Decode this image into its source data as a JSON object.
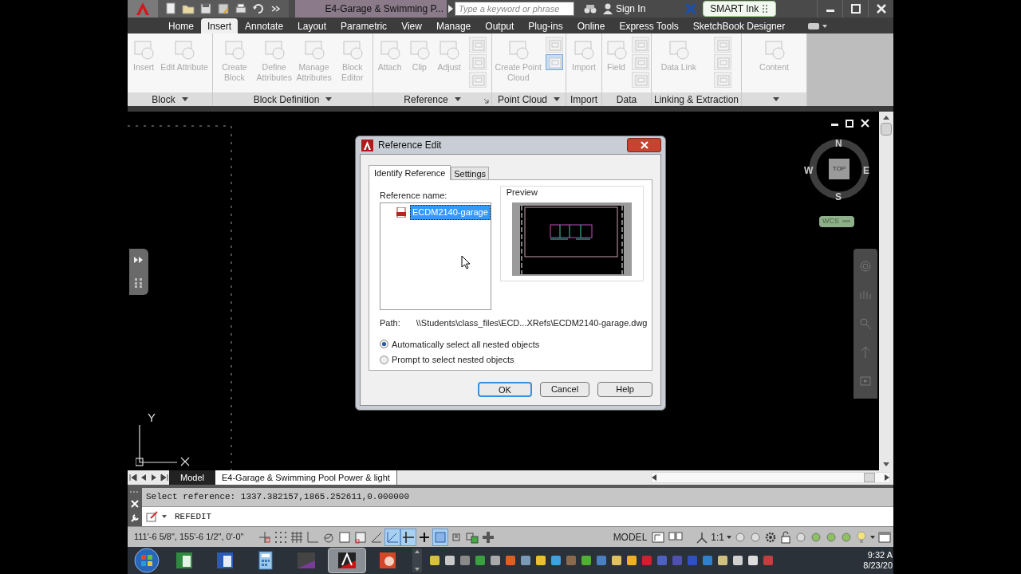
{
  "title_bar": {
    "title": "E4-Garage & Swimming P...",
    "search_placeholder": "Type a keyword or phrase",
    "sign_in": "Sign In",
    "smart_ink": "SMART Ink"
  },
  "ribbon_tabs": [
    {
      "label": "Home",
      "selected": false
    },
    {
      "label": "Insert",
      "selected": true
    },
    {
      "label": "Annotate",
      "selected": false
    },
    {
      "label": "Layout",
      "selected": false
    },
    {
      "label": "Parametric",
      "selected": false
    },
    {
      "label": "View",
      "selected": false
    },
    {
      "label": "Manage",
      "selected": false
    },
    {
      "label": "Output",
      "selected": false
    },
    {
      "label": "Plug-ins",
      "selected": false
    },
    {
      "label": "Online",
      "selected": false
    },
    {
      "label": "Express Tools",
      "selected": false
    },
    {
      "label": "SketchBook Designer",
      "selected": false
    }
  ],
  "ribbon_panels": [
    {
      "title": "Block",
      "has_menu": true,
      "launcher": false,
      "buttons": [
        {
          "label": "Insert",
          "disabled": true
        },
        {
          "label": "Edit Attribute",
          "disabled": true
        }
      ]
    },
    {
      "title": "Block Definition",
      "has_menu": true,
      "launcher": false,
      "buttons": [
        {
          "label": "Create Block",
          "disabled": true
        },
        {
          "label": "Define Attributes",
          "disabled": true
        },
        {
          "label": "Manage Attributes",
          "disabled": true
        },
        {
          "label": "Block Editor",
          "disabled": true
        }
      ]
    },
    {
      "title": "Reference",
      "has_menu": true,
      "launcher": true,
      "buttons": [
        {
          "label": "Attach",
          "disabled": true
        },
        {
          "label": "Clip",
          "disabled": true
        },
        {
          "label": "Adjust",
          "disabled": true
        }
      ],
      "small_buttons": [
        {
          "highlighted": false
        },
        {
          "highlighted": false
        },
        {
          "highlighted": false
        }
      ]
    },
    {
      "title": "Point Cloud",
      "has_menu": true,
      "launcher": false,
      "buttons": [
        {
          "label": "Create Point Cloud",
          "disabled": true
        }
      ],
      "small_buttons": [
        {
          "highlighted": false
        },
        {
          "highlighted": true
        }
      ]
    },
    {
      "title": "Import",
      "has_menu": false,
      "launcher": false,
      "buttons": [
        {
          "label": "Import",
          "disabled": true
        }
      ]
    },
    {
      "title": "Data",
      "has_menu": false,
      "launcher": false,
      "buttons": [
        {
          "label": "Field",
          "disabled": true
        }
      ],
      "small_buttons": [
        {
          "highlighted": false
        },
        {
          "highlighted": false
        },
        {
          "highlighted": false
        }
      ]
    },
    {
      "title": "Linking & Extraction",
      "has_menu": false,
      "launcher": false,
      "buttons": [
        {
          "label": "Data Link",
          "disabled": true
        }
      ],
      "small_buttons": [
        {
          "highlighted": false
        },
        {
          "highlighted": false
        },
        {
          "highlighted": false
        }
      ]
    },
    {
      "has_menu": true,
      "launcher": false,
      "buttons": [
        {
          "label": "Content",
          "disabled": true
        }
      ]
    }
  ],
  "dialog": {
    "title": "Reference Edit",
    "tabs": [
      {
        "label": "Identify Reference",
        "selected": true
      },
      {
        "label": "Settings",
        "selected": false
      }
    ],
    "reference_label": "Reference name:",
    "references": [
      {
        "name": "ECDM2140-garage",
        "selected": true
      }
    ],
    "preview_label": "Preview",
    "path_label": "Path:",
    "path": "\\\\Students\\class_files\\ECD...XRefs\\ECDM2140-garage.dwg",
    "options": [
      {
        "label": "Automatically select all nested objects",
        "selected": true
      },
      {
        "label": "Prompt to select nested objects",
        "selected": false
      }
    ],
    "buttons": [
      {
        "label": "OK",
        "default": true
      },
      {
        "label": "Cancel",
        "default": false
      },
      {
        "label": "Help",
        "default": false
      }
    ]
  },
  "viewcube": {
    "top": "TOP",
    "north": "N",
    "south": "S",
    "east": "E",
    "west": "W",
    "ucs": "WCS"
  },
  "ucs_icon": {
    "y_label": "Y"
  },
  "layout_tabs": [
    {
      "label": "Model",
      "selected": true
    },
    {
      "label": "E4-Garage & Swimming Pool Power & light",
      "selected": false
    }
  ],
  "command_line": {
    "history": "Select reference: 1337.382157,1865.252611,0.000000",
    "input": "REFEDIT"
  },
  "status_bar": {
    "coordinates": "111'-6 5/8\", 155'-6 1/2\", 0'-0\"",
    "toggles": [
      {
        "on": false
      },
      {
        "on": false
      },
      {
        "on": false
      },
      {
        "on": false
      },
      {
        "on": false
      },
      {
        "on": false
      },
      {
        "on": false
      },
      {
        "on": false
      },
      {
        "on": true
      },
      {
        "on": true
      },
      {
        "on": false
      },
      {
        "on": true
      },
      {
        "on": false
      },
      {
        "on": false
      },
      {
        "on": false
      }
    ],
    "model": "MODEL",
    "scale": "1:1"
  },
  "taskbar": {
    "apps": [
      {
        "selected": false
      },
      {
        "selected": false
      },
      {
        "selected": false
      },
      {
        "selected": false
      },
      {
        "selected": true
      },
      {
        "selected": false
      }
    ],
    "time": "9:32 A",
    "date": "8/23/20"
  }
}
